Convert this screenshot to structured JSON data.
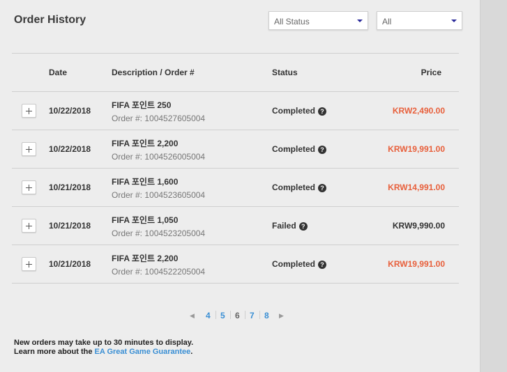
{
  "page": {
    "title": "Order History"
  },
  "filters": {
    "status_selected": "All Status",
    "range_selected": "All"
  },
  "table": {
    "headers": {
      "date": "Date",
      "description": "Description / Order #",
      "status": "Status",
      "price": "Price"
    },
    "rows": [
      {
        "date": "10/22/2018",
        "description": "FIFA 포인트 250",
        "order": "Order #: 1004527605004",
        "status": "Completed",
        "price": "KRW2,490.00",
        "price_color": "#e8603c"
      },
      {
        "date": "10/22/2018",
        "description": "FIFA 포인트 2,200",
        "order": "Order #: 1004526005004",
        "status": "Completed",
        "price": "KRW19,991.00",
        "price_color": "#e8603c"
      },
      {
        "date": "10/21/2018",
        "description": "FIFA 포인트 1,600",
        "order": "Order #: 1004523605004",
        "status": "Completed",
        "price": "KRW14,991.00",
        "price_color": "#e8603c"
      },
      {
        "date": "10/21/2018",
        "description": "FIFA 포인트 1,050",
        "order": "Order #: 1004523205004",
        "status": "Failed",
        "price": "KRW9,990.00",
        "price_color": "#333333"
      },
      {
        "date": "10/21/2018",
        "description": "FIFA 포인트 2,200",
        "order": "Order #: 1004522205004",
        "status": "Completed",
        "price": "KRW19,991.00",
        "price_color": "#e8603c"
      }
    ]
  },
  "pagination": {
    "prev_icon": "caret-left-icon",
    "next_icon": "caret-right-icon",
    "pages": [
      "4",
      "5",
      "6",
      "7",
      "8"
    ],
    "current": "6"
  },
  "footer": {
    "line1": "New orders may take up to 30 minutes to display.",
    "line2_prefix": "Learn more about the ",
    "line2_link": "EA Great Game Guarantee",
    "line2_suffix": "."
  },
  "colors": {
    "accent_link": "#3a8fd4",
    "price_highlight": "#e8603c"
  }
}
